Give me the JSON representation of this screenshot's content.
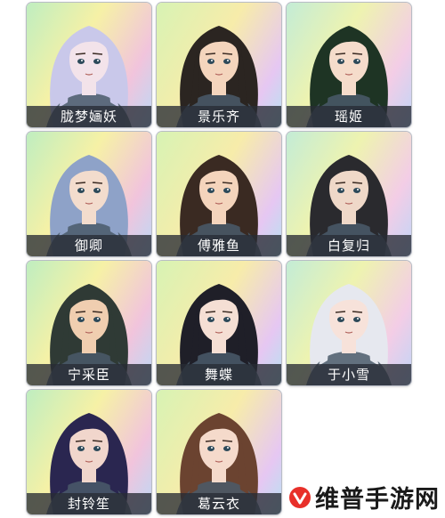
{
  "characters": [
    {
      "name": "胧梦婳妖",
      "hair": "#c9c8ea",
      "skin": "#f3e3ea",
      "bg": "bg-a"
    },
    {
      "name": "景乐齐",
      "hair": "#2b2521",
      "skin": "#f4d5bd",
      "bg": "bg-b"
    },
    {
      "name": "瑶姬",
      "hair": "#1e3424",
      "skin": "#f5dccb",
      "bg": "bg-c"
    },
    {
      "name": "御卿",
      "hair": "#8ea2c8",
      "skin": "#f3dccd",
      "bg": "bg-a"
    },
    {
      "name": "傅雅鱼",
      "hair": "#3a2a22",
      "skin": "#f4d4bc",
      "bg": "bg-b"
    },
    {
      "name": "白复归",
      "hair": "#2a2a2e",
      "skin": "#efd8c8",
      "bg": "bg-c"
    },
    {
      "name": "宁采臣",
      "hair": "#2f3a35",
      "skin": "#f0ceb0",
      "bg": "bg-a"
    },
    {
      "name": "舞蝶",
      "hair": "#1f1f28",
      "skin": "#f5dfd4",
      "bg": "bg-b"
    },
    {
      "name": "于小雪",
      "hair": "#e6e8ef",
      "skin": "#f7e2da",
      "bg": "bg-c"
    },
    {
      "name": "封铃笙",
      "hair": "#2a2650",
      "skin": "#f1d6cc",
      "bg": "bg-a"
    },
    {
      "name": "葛云衣",
      "hair": "#6b4330",
      "skin": "#f5dacb",
      "bg": "bg-b"
    }
  ],
  "watermark": {
    "text": "维普手游网"
  }
}
